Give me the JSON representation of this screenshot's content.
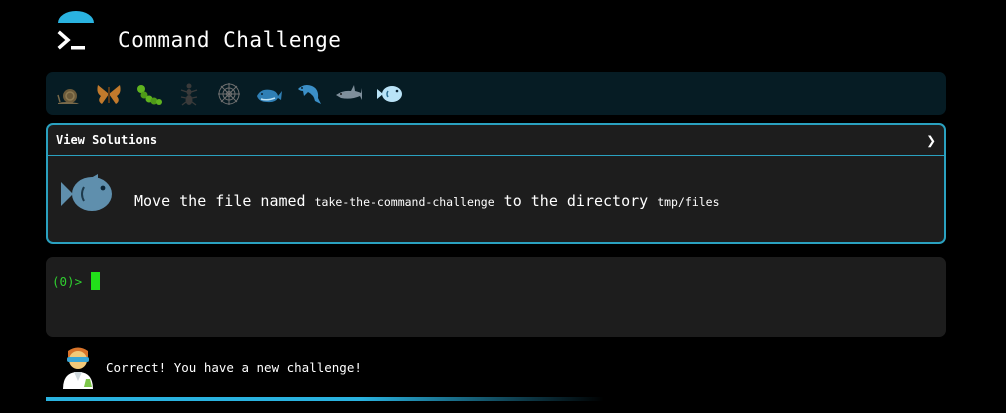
{
  "app": {
    "title": "Command Challenge"
  },
  "levels": [
    {
      "icon": "snail-icon"
    },
    {
      "icon": "butterfly-icon"
    },
    {
      "icon": "caterpillar-icon"
    },
    {
      "icon": "ant-icon"
    },
    {
      "icon": "spider-web-icon"
    },
    {
      "icon": "whale-icon"
    },
    {
      "icon": "dolphin-icon"
    },
    {
      "icon": "shark-icon"
    },
    {
      "icon": "fish-icon",
      "active": true
    }
  ],
  "solutions": {
    "label": "View Solutions",
    "chevron": "❯"
  },
  "challenge": {
    "text_before": "Move the file named ",
    "file": "take-the-command-challenge",
    "text_middle": " to the directory ",
    "dir": "tmp/files"
  },
  "terminal": {
    "prompt": "(0)>",
    "value": ""
  },
  "feedback": {
    "message": "Correct! You have a new challenge!"
  },
  "colors": {
    "accent": "#2aa1c0",
    "prompt_green": "#2fcf2f",
    "panel": "#1d1d1d",
    "level_bar": "#061c24"
  },
  "progress": {
    "fraction": 0.45
  }
}
